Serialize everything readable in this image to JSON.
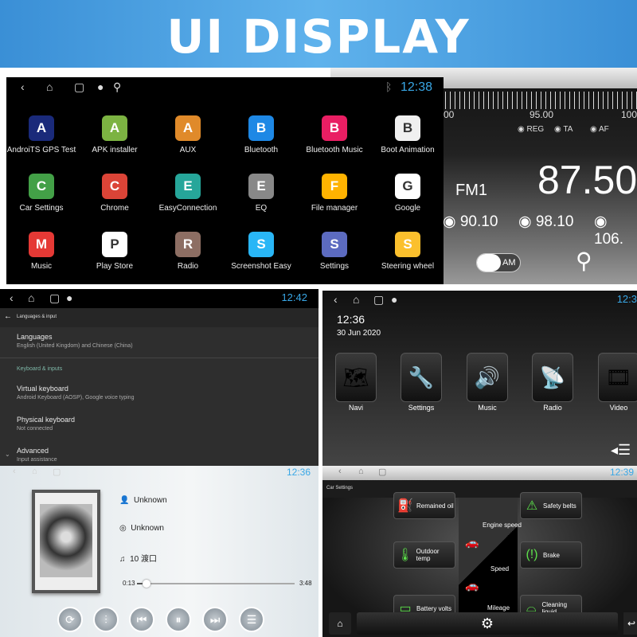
{
  "banner": {
    "title": "UI DISPLAY",
    "color": "#4aa3e4"
  },
  "apps_screen": {
    "time": "12:38",
    "apps": [
      {
        "label": "AndroiTS GPS Test",
        "icon": "gps-globe-icon",
        "color": "#1a2a7a"
      },
      {
        "label": "APK installer",
        "icon": "android-icon",
        "color": "#7cb342"
      },
      {
        "label": "AUX",
        "icon": "aux-sliders-icon",
        "color": "#e08a2a"
      },
      {
        "label": "Bluetooth",
        "icon": "bluetooth-icon",
        "color": "#1e88e5"
      },
      {
        "label": "Bluetooth Music",
        "icon": "bluetooth-music-icon",
        "color": "#e91e63"
      },
      {
        "label": "Boot Animation",
        "icon": "boot-animation-icon",
        "color": "#f0f0f0"
      },
      {
        "label": "Car Settings",
        "icon": "car-settings-icon",
        "color": "#43a047"
      },
      {
        "label": "Chrome",
        "icon": "chrome-icon",
        "color": "#db4437"
      },
      {
        "label": "EasyConnection",
        "icon": "easyconnection-icon",
        "color": "#26a69a"
      },
      {
        "label": "EQ",
        "icon": "eq-icon",
        "color": "#888888"
      },
      {
        "label": "File manager",
        "icon": "folder-icon",
        "color": "#ffb300"
      },
      {
        "label": "Google",
        "icon": "google-icon",
        "color": "#ffffff"
      },
      {
        "label": "Music",
        "icon": "music-icon",
        "color": "#e53935"
      },
      {
        "label": "Play Store",
        "icon": "play-store-icon",
        "color": "#ffffff"
      },
      {
        "label": "Radio",
        "icon": "radio-icon",
        "color": "#8d6e63"
      },
      {
        "label": "Screenshot Easy",
        "icon": "camera-icon",
        "color": "#29b6f6"
      },
      {
        "label": "Settings",
        "icon": "gear-icon",
        "color": "#5c6bc0"
      },
      {
        "label": "Steering wheel",
        "icon": "steering-wheel-icon",
        "color": "#fbc02d"
      }
    ]
  },
  "radio": {
    "scale": [
      "00",
      "95.00",
      "100"
    ],
    "options": [
      "REG",
      "TA",
      "AF"
    ],
    "band": "FM1",
    "frequency": "87.50",
    "presets": [
      "90.10",
      "98.10",
      "106."
    ],
    "am_label": "AM"
  },
  "settings_screen": {
    "time": "12:42",
    "title": "Languages & input",
    "items": [
      {
        "title": "Languages",
        "sub": "English (United Kingdom) and Chinese (China)"
      },
      {
        "title": "Virtual keyboard",
        "sub": "Android Keyboard (AOSP), Google voice typing"
      },
      {
        "title": "Physical keyboard",
        "sub": "Not connected"
      },
      {
        "title": "Advanced",
        "sub": "Input assistance"
      }
    ],
    "section": "Keyboard & inputs"
  },
  "home_screen": {
    "time": "12:3",
    "clock": "12:36",
    "date": "30 Jun 2020",
    "tiles": [
      "Navi",
      "Settings",
      "Music",
      "Radio",
      "Video"
    ]
  },
  "music_screen": {
    "time": "12:36",
    "artist": "Unknown",
    "album": "Unknown",
    "track": "10 渡口",
    "elapsed": "0:13",
    "duration": "3:48",
    "progress": 0.06
  },
  "car_screen": {
    "time": "12:39",
    "title": "Car Settings",
    "left": [
      "Remained oil",
      "Outdoor temp",
      "Battery volts"
    ],
    "center": [
      "Engine speed",
      "Speed",
      "Mileage"
    ],
    "right": [
      "Safety belts",
      "Brake",
      "Cleaning liquid"
    ],
    "accent": "#5ce04a"
  }
}
